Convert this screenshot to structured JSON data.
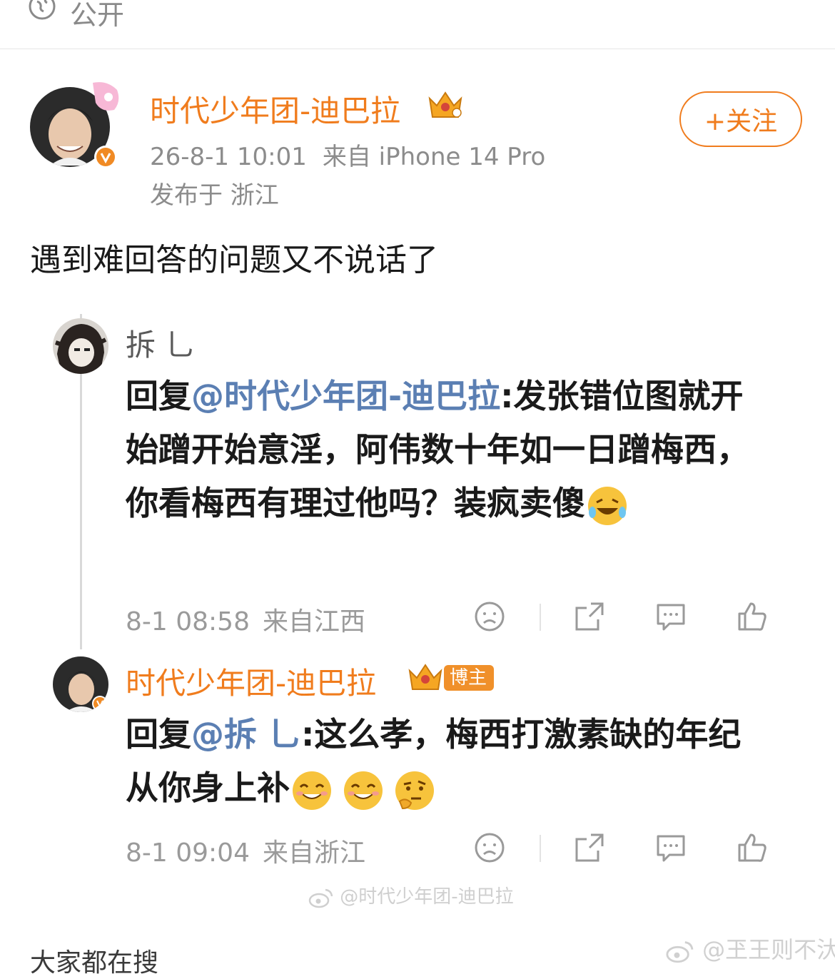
{
  "visibility": {
    "icon": "globe-icon",
    "label": "公开"
  },
  "post": {
    "author": "时代少年团-迪巴拉",
    "time": "26-8-1 10:01",
    "source": "来自 iPhone 14 Pro",
    "location": "发布于 浙江",
    "follow_label": "+关注",
    "text": "遇到难回答的问题又不说话了"
  },
  "comments": [
    {
      "user": "拆 乚",
      "reply_prefix": "回复",
      "mention": "@时代少年团-迪巴拉",
      "body": ":发张错位图就开始蹭开始意淫，阿伟数十年如一日蹭梅西，你看梅西有理过他吗？装疯卖傻",
      "emojis": [
        "laugh-tears-emoji"
      ],
      "time": "8-1 08:58",
      "source": "来自江西"
    },
    {
      "user": "时代少年团-迪巴拉",
      "badge": "博主",
      "reply_prefix": "回复",
      "mention": "@拆 乚",
      "body": ":这么孝，梅西打激素缺的年纪从你身上补",
      "emojis": [
        "smile-emoji",
        "smile-emoji",
        "thinking-emoji"
      ],
      "time": "8-1 09:04",
      "source": "来自浙江"
    }
  ],
  "watermarks": {
    "inner": "@时代少年团-迪巴拉",
    "outer": "@玊王则不汏"
  },
  "bottom_hint": "大家都在搜",
  "colors": {
    "accent": "#f07c1d",
    "mention": "#5b7fb3",
    "muted": "#8c8c8c"
  }
}
